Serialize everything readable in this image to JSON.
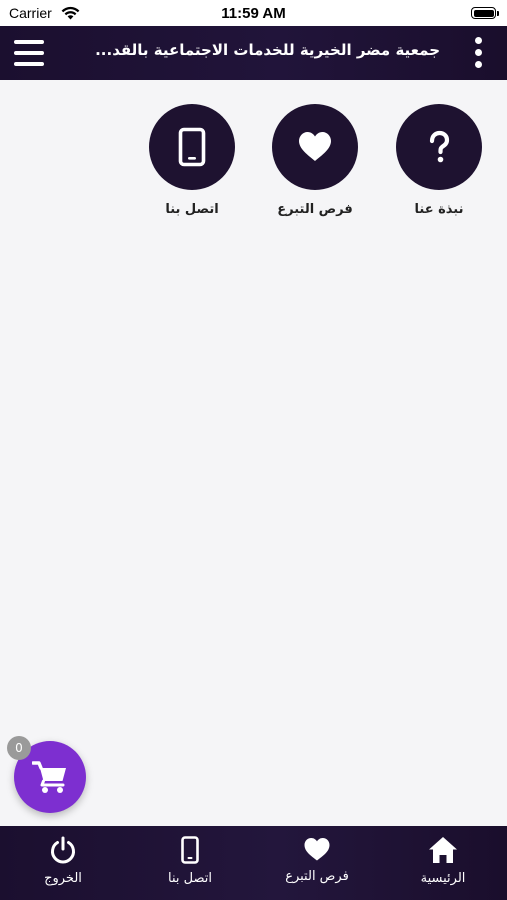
{
  "status_bar": {
    "carrier": "Carrier",
    "time": "11:59 AM"
  },
  "header": {
    "title": "جمعية مضر الخيرية للخدمات الاجتماعية بالقد..."
  },
  "shortcuts": [
    {
      "label": "نبذة عنا",
      "icon": "question-icon"
    },
    {
      "label": "فرص التبرع",
      "icon": "heart-icon"
    },
    {
      "label": "اتصل بنا",
      "icon": "phone-icon"
    }
  ],
  "cart": {
    "count": "0",
    "icon": "cart-icon",
    "color": "#7d2fd0"
  },
  "tabs": [
    {
      "label": "الرئيسية",
      "icon": "home-icon"
    },
    {
      "label": "فرص التبرع",
      "icon": "heart-icon"
    },
    {
      "label": "اتصل بنا",
      "icon": "phone-icon"
    },
    {
      "label": "الخروج",
      "icon": "power-icon"
    }
  ],
  "colors": {
    "header_bg": "#1b0f2f",
    "icon_circle": "#1e1230",
    "page_bg": "#f5f5f7"
  }
}
